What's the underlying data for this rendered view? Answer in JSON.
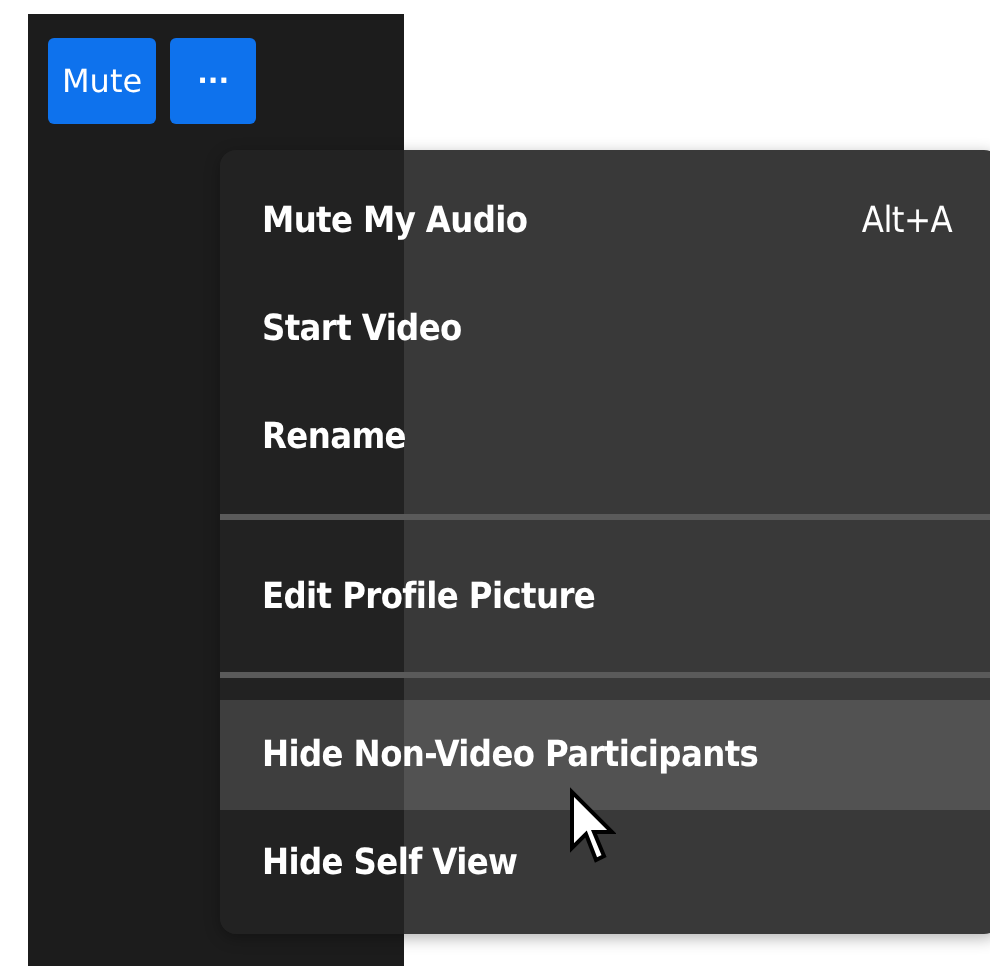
{
  "toolbar": {
    "buttons": [
      {
        "kind": "text",
        "label": "Mute"
      },
      {
        "kind": "more",
        "label": "···"
      }
    ]
  },
  "menu": {
    "items": [
      {
        "kind": "item",
        "label": "Mute My Audio",
        "shortcut": "Alt+A",
        "selected": false
      },
      {
        "kind": "item",
        "label": "Start Video",
        "selected": false
      },
      {
        "kind": "item",
        "label": "Rename",
        "selected": false
      },
      {
        "kind": "separator"
      },
      {
        "kind": "item",
        "label": "Edit Profile Picture",
        "selected": false
      },
      {
        "kind": "separator"
      },
      {
        "kind": "item",
        "label": "Hide Non-Video Participants",
        "selected": true
      },
      {
        "kind": "item",
        "label": "Hide Self View",
        "selected": false
      }
    ]
  }
}
